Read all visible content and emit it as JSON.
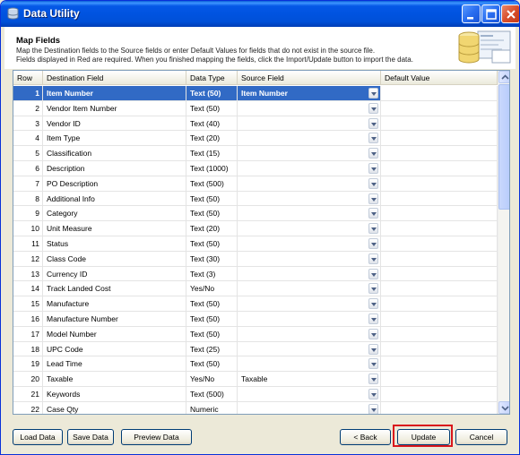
{
  "window": {
    "title": "Data Utility"
  },
  "header": {
    "title": "Map Fields",
    "line1": "Map the Destination fields to the Source fields or enter Default Values for fields that do not exist in the source file.",
    "line2": "Fields displayed in Red are required.  When you finished mapping the fields, click the Import/Update button to import the data."
  },
  "grid": {
    "columns": [
      "Row",
      "Destination Field",
      "Data Type",
      "Source Field",
      "Default Value"
    ],
    "rows": [
      {
        "num": "1",
        "dest": "Item Number",
        "type": "Text (50)",
        "source": "Item Number",
        "default": ""
      },
      {
        "num": "2",
        "dest": "Vendor Item Number",
        "type": "Text (50)",
        "source": "",
        "default": ""
      },
      {
        "num": "3",
        "dest": "Vendor ID",
        "type": "Text (40)",
        "source": "",
        "default": ""
      },
      {
        "num": "4",
        "dest": "Item Type",
        "type": "Text (20)",
        "source": "",
        "default": ""
      },
      {
        "num": "5",
        "dest": "Classification",
        "type": "Text (15)",
        "source": "",
        "default": ""
      },
      {
        "num": "6",
        "dest": "Description",
        "type": "Text (1000)",
        "source": "",
        "default": ""
      },
      {
        "num": "7",
        "dest": "PO Description",
        "type": "Text (500)",
        "source": "",
        "default": ""
      },
      {
        "num": "8",
        "dest": "Additional Info",
        "type": "Text (50)",
        "source": "",
        "default": ""
      },
      {
        "num": "9",
        "dest": "Category",
        "type": "Text (50)",
        "source": "",
        "default": ""
      },
      {
        "num": "10",
        "dest": "Unit Measure",
        "type": "Text (20)",
        "source": "",
        "default": ""
      },
      {
        "num": "11",
        "dest": "Status",
        "type": "Text (50)",
        "source": "",
        "default": ""
      },
      {
        "num": "12",
        "dest": "Class Code",
        "type": "Text (30)",
        "source": "",
        "default": ""
      },
      {
        "num": "13",
        "dest": "Currency ID",
        "type": "Text (3)",
        "source": "",
        "default": ""
      },
      {
        "num": "14",
        "dest": "Track Landed Cost",
        "type": "Yes/No",
        "source": "",
        "default": ""
      },
      {
        "num": "15",
        "dest": "Manufacture",
        "type": "Text (50)",
        "source": "",
        "default": ""
      },
      {
        "num": "16",
        "dest": "Manufacture Number",
        "type": "Text (50)",
        "source": "",
        "default": ""
      },
      {
        "num": "17",
        "dest": "Model Number",
        "type": "Text (50)",
        "source": "",
        "default": ""
      },
      {
        "num": "18",
        "dest": "UPC Code",
        "type": "Text (25)",
        "source": "",
        "default": ""
      },
      {
        "num": "19",
        "dest": "Lead Time",
        "type": "Text (50)",
        "source": "",
        "default": ""
      },
      {
        "num": "20",
        "dest": "Taxable",
        "type": "Yes/No",
        "source": "Taxable",
        "default": ""
      },
      {
        "num": "21",
        "dest": "Keywords",
        "type": "Text (500)",
        "source": "",
        "default": ""
      },
      {
        "num": "22",
        "dest": "Case Qty",
        "type": "Numeric",
        "source": "",
        "default": ""
      }
    ]
  },
  "buttons": {
    "load": "Load Data",
    "save": "Save Data",
    "preview": "Preview Data",
    "back": "< Back",
    "update": "Update",
    "cancel": "Cancel"
  },
  "colors": {
    "titlebar": "#0053e0",
    "selection": "#316ac5",
    "highlight": "#d9171c"
  }
}
